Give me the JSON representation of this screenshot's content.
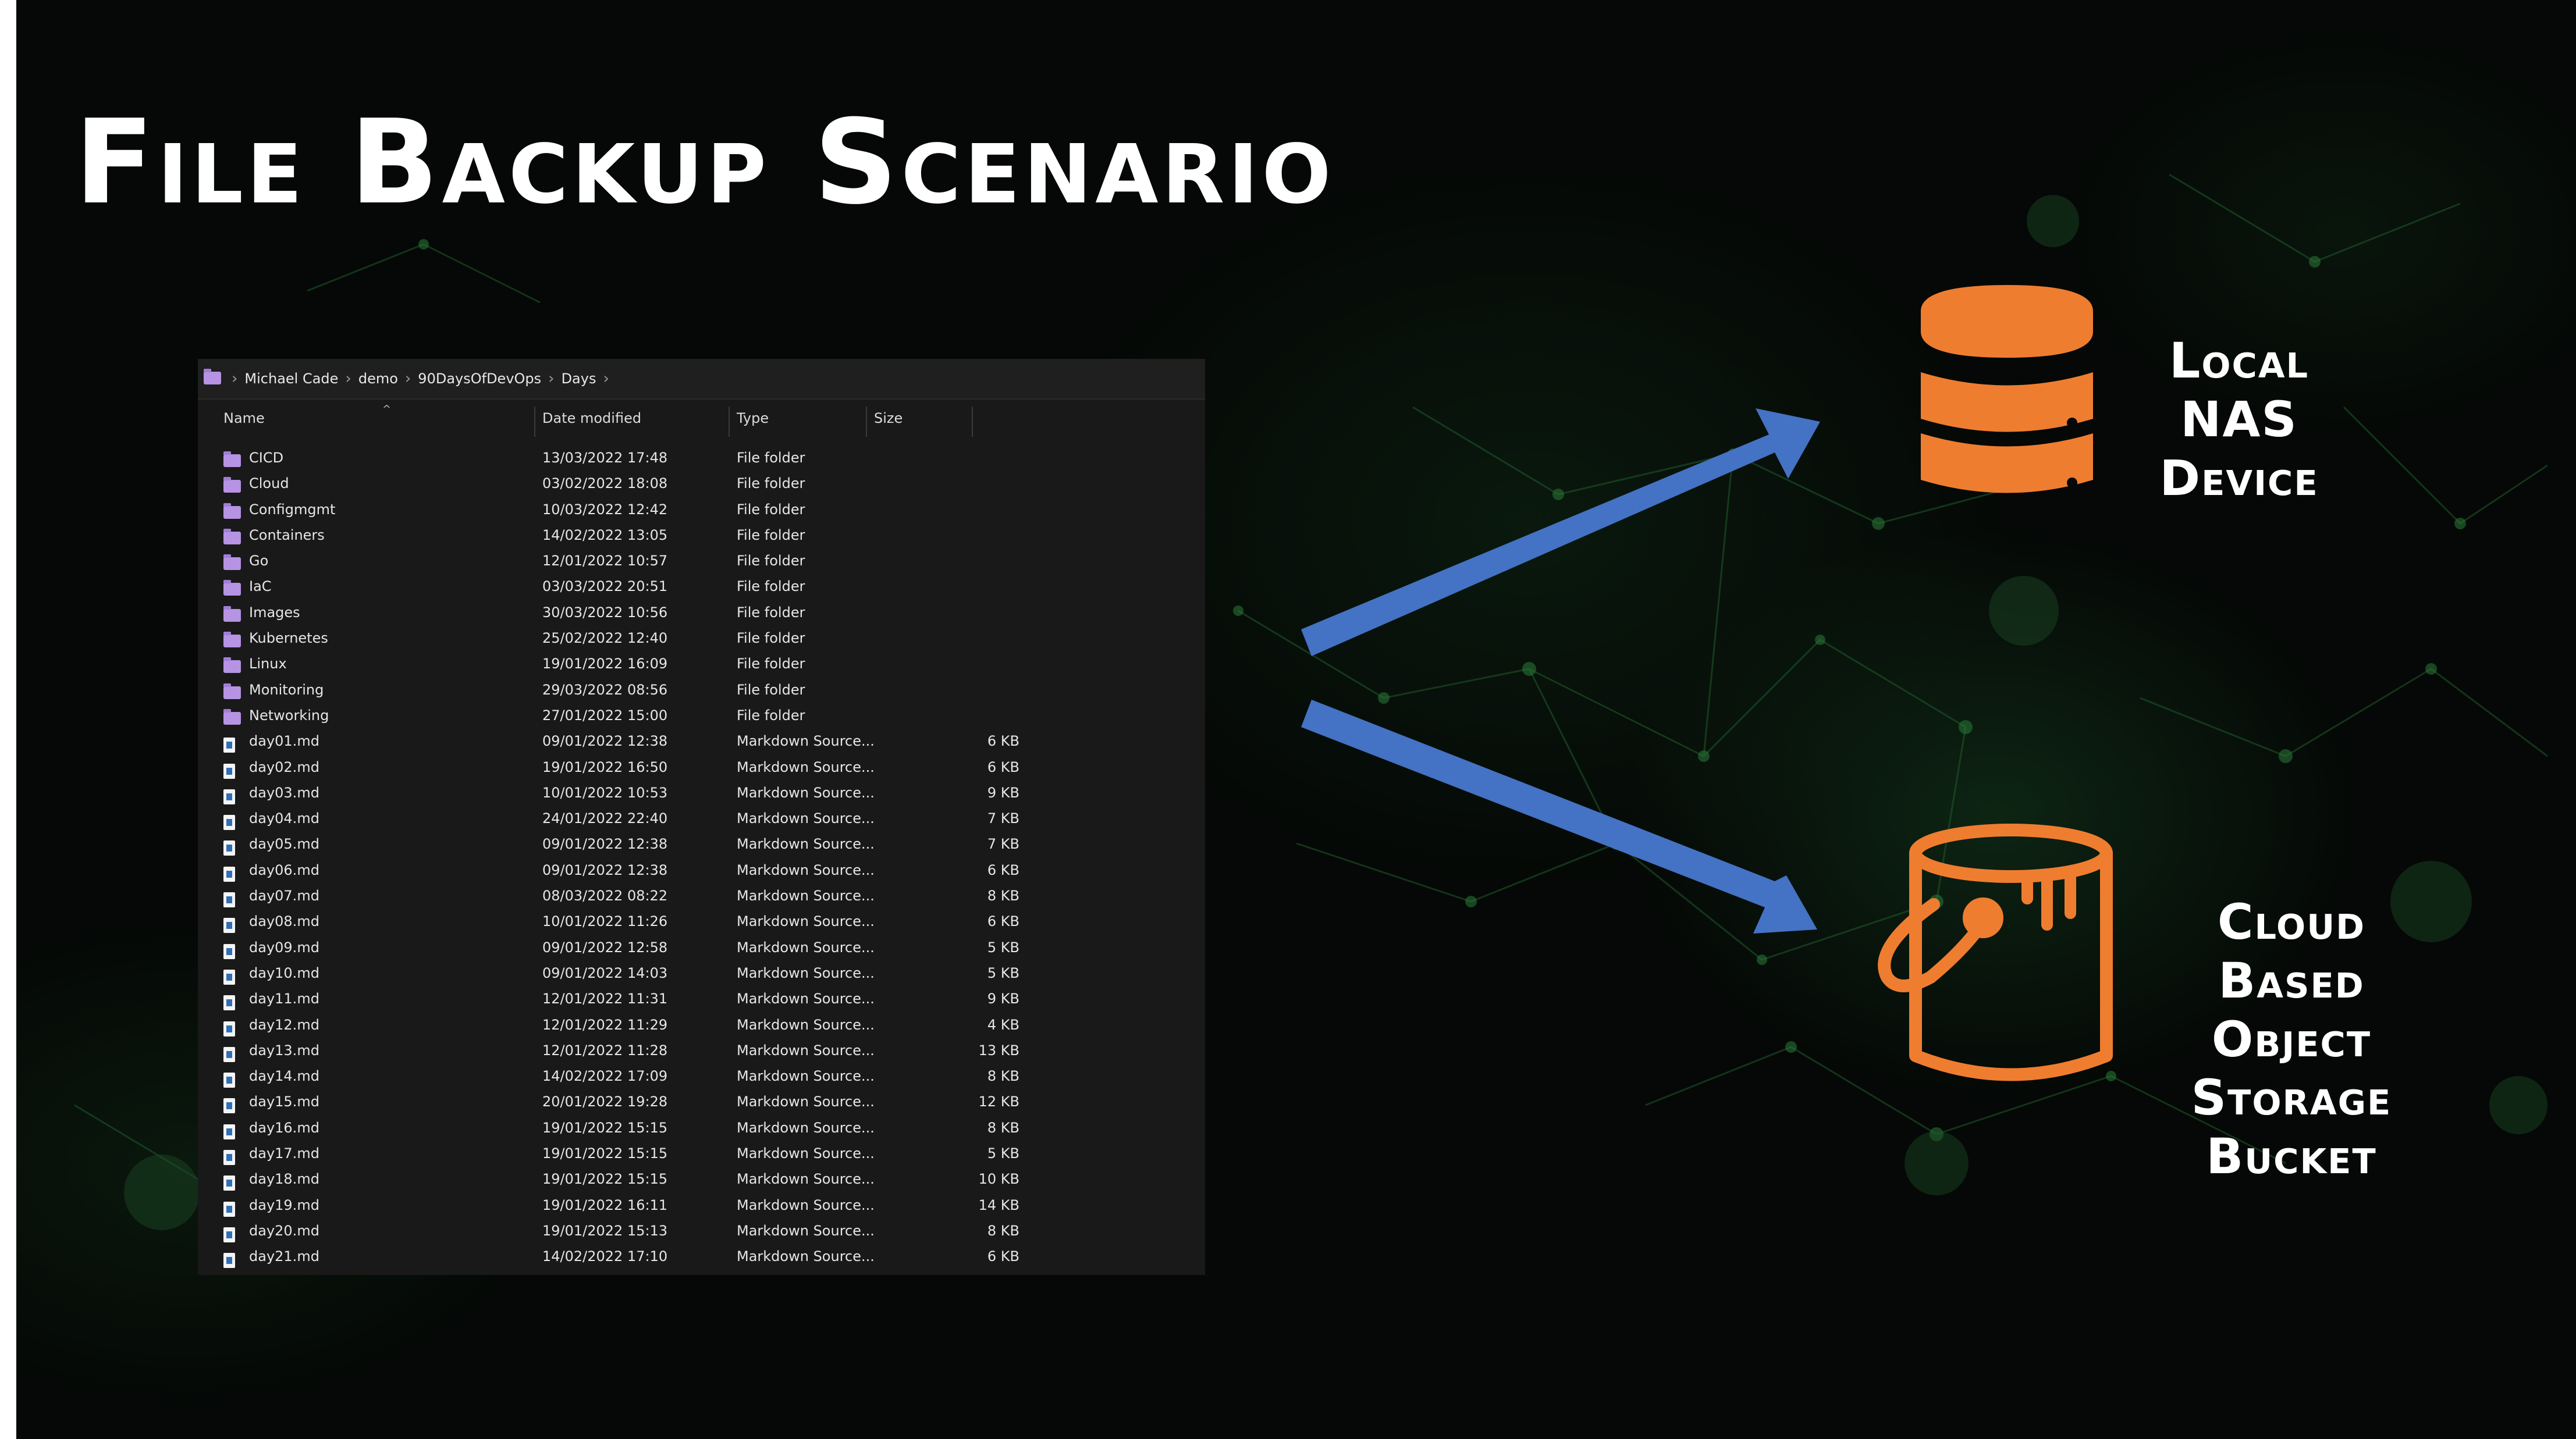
{
  "slide": {
    "title": "File Backup Scenario"
  },
  "explorer": {
    "breadcrumb": [
      "Michael Cade",
      "demo",
      "90DaysOfDevOps",
      "Days"
    ],
    "columns": {
      "name": "Name",
      "date": "Date modified",
      "type": "Type",
      "size": "Size"
    },
    "rows": [
      {
        "name": "CICD",
        "date": "13/03/2022 17:48",
        "type": "File folder",
        "size": "",
        "kind": "folder"
      },
      {
        "name": "Cloud",
        "date": "03/02/2022 18:08",
        "type": "File folder",
        "size": "",
        "kind": "folder"
      },
      {
        "name": "Configmgmt",
        "date": "10/03/2022 12:42",
        "type": "File folder",
        "size": "",
        "kind": "folder"
      },
      {
        "name": "Containers",
        "date": "14/02/2022 13:05",
        "type": "File folder",
        "size": "",
        "kind": "folder"
      },
      {
        "name": "Go",
        "date": "12/01/2022 10:57",
        "type": "File folder",
        "size": "",
        "kind": "folder"
      },
      {
        "name": "IaC",
        "date": "03/03/2022 20:51",
        "type": "File folder",
        "size": "",
        "kind": "folder"
      },
      {
        "name": "Images",
        "date": "30/03/2022 10:56",
        "type": "File folder",
        "size": "",
        "kind": "folder"
      },
      {
        "name": "Kubernetes",
        "date": "25/02/2022 12:40",
        "type": "File folder",
        "size": "",
        "kind": "folder"
      },
      {
        "name": "Linux",
        "date": "19/01/2022 16:09",
        "type": "File folder",
        "size": "",
        "kind": "folder"
      },
      {
        "name": "Monitoring",
        "date": "29/03/2022 08:56",
        "type": "File folder",
        "size": "",
        "kind": "folder"
      },
      {
        "name": "Networking",
        "date": "27/01/2022 15:00",
        "type": "File folder",
        "size": "",
        "kind": "folder"
      },
      {
        "name": "day01.md",
        "date": "09/01/2022 12:38",
        "type": "Markdown Source...",
        "size": "6 KB",
        "kind": "file"
      },
      {
        "name": "day02.md",
        "date": "19/01/2022 16:50",
        "type": "Markdown Source...",
        "size": "6 KB",
        "kind": "file"
      },
      {
        "name": "day03.md",
        "date": "10/01/2022 10:53",
        "type": "Markdown Source...",
        "size": "9 KB",
        "kind": "file"
      },
      {
        "name": "day04.md",
        "date": "24/01/2022 22:40",
        "type": "Markdown Source...",
        "size": "7 KB",
        "kind": "file"
      },
      {
        "name": "day05.md",
        "date": "09/01/2022 12:38",
        "type": "Markdown Source...",
        "size": "7 KB",
        "kind": "file"
      },
      {
        "name": "day06.md",
        "date": "09/01/2022 12:38",
        "type": "Markdown Source...",
        "size": "6 KB",
        "kind": "file"
      },
      {
        "name": "day07.md",
        "date": "08/03/2022 08:22",
        "type": "Markdown Source...",
        "size": "8 KB",
        "kind": "file"
      },
      {
        "name": "day08.md",
        "date": "10/01/2022 11:26",
        "type": "Markdown Source...",
        "size": "6 KB",
        "kind": "file"
      },
      {
        "name": "day09.md",
        "date": "09/01/2022 12:58",
        "type": "Markdown Source...",
        "size": "5 KB",
        "kind": "file"
      },
      {
        "name": "day10.md",
        "date": "09/01/2022 14:03",
        "type": "Markdown Source...",
        "size": "5 KB",
        "kind": "file"
      },
      {
        "name": "day11.md",
        "date": "12/01/2022 11:31",
        "type": "Markdown Source...",
        "size": "9 KB",
        "kind": "file"
      },
      {
        "name": "day12.md",
        "date": "12/01/2022 11:29",
        "type": "Markdown Source...",
        "size": "4 KB",
        "kind": "file"
      },
      {
        "name": "day13.md",
        "date": "12/01/2022 11:28",
        "type": "Markdown Source...",
        "size": "13 KB",
        "kind": "file"
      },
      {
        "name": "day14.md",
        "date": "14/02/2022 17:09",
        "type": "Markdown Source...",
        "size": "8 KB",
        "kind": "file"
      },
      {
        "name": "day15.md",
        "date": "20/01/2022 19:28",
        "type": "Markdown Source...",
        "size": "12 KB",
        "kind": "file"
      },
      {
        "name": "day16.md",
        "date": "19/01/2022 15:15",
        "type": "Markdown Source...",
        "size": "8 KB",
        "kind": "file"
      },
      {
        "name": "day17.md",
        "date": "19/01/2022 15:15",
        "type": "Markdown Source...",
        "size": "5 KB",
        "kind": "file"
      },
      {
        "name": "day18.md",
        "date": "19/01/2022 15:15",
        "type": "Markdown Source...",
        "size": "10 KB",
        "kind": "file"
      },
      {
        "name": "day19.md",
        "date": "19/01/2022 16:11",
        "type": "Markdown Source...",
        "size": "14 KB",
        "kind": "file"
      },
      {
        "name": "day20.md",
        "date": "19/01/2022 15:13",
        "type": "Markdown Source...",
        "size": "8 KB",
        "kind": "file"
      },
      {
        "name": "day21.md",
        "date": "14/02/2022 17:10",
        "type": "Markdown Source...",
        "size": "6 KB",
        "kind": "file"
      }
    ]
  },
  "targets": {
    "nas": {
      "lines": [
        "Local NAS",
        "Device"
      ],
      "icon": "database-icon",
      "color": "#ef7d30"
    },
    "cloud": {
      "lines": [
        "Cloud",
        "Based",
        "Object",
        "Storage",
        "Bucket"
      ],
      "icon": "bucket-icon",
      "color": "#ef7d30"
    }
  },
  "colors": {
    "arrow": "#4472c4",
    "background": "#050806",
    "folder": "#b693e3"
  }
}
